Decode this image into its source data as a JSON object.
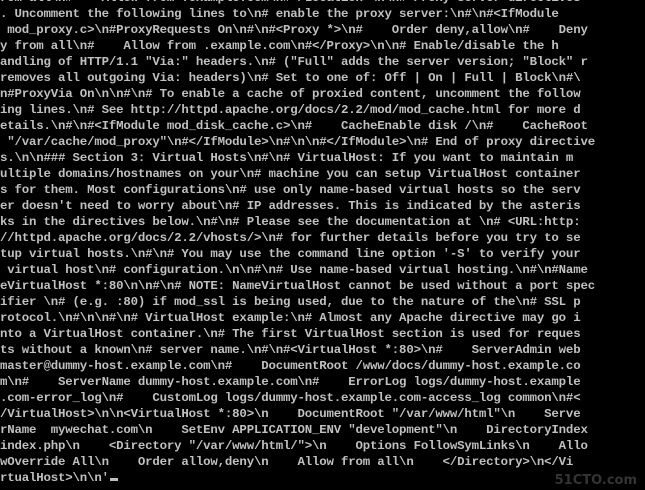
{
  "terminal": {
    "background_color": "#000000",
    "text_color": "#c0c0c0",
    "lines": [
      "rom all\\n#    Allow from .example.com\\n#</Location>\\n\\n# Proxy Server directives",
      ". Uncomment the following lines to\\n# enable the proxy server:\\n#\\n#<IfModule",
      " mod_proxy.c>\\n#ProxyRequests On\\n#\\n#<Proxy *>\\n#    Order deny,allow\\n#    Deny",
      "y from all\\n#    Allow from .example.com\\n#</Proxy>\\n\\n# Enable/disable the h",
      "andling of HTTP/1.1 \"Via:\" headers.\\n# (\"Full\" adds the server version; \"Block\" r",
      "removes all outgoing Via: headers)\\n# Set to one of: Off | On | Full | Block\\n#\\",
      "n#ProxyVia On\\n\\n#\\n# To enable a cache of proxied content, uncomment the follow",
      "ing lines.\\n# See http://httpd.apache.org/docs/2.2/mod/mod_cache.html for more d",
      "etails.\\n#\\n#<IfModule mod_disk_cache.c>\\n#    CacheEnable disk /\\n#    CacheRoot",
      " \"/var/cache/mod_proxy\"\\n#</IfModule>\\n#\\n\\n#</IfModule>\\n# End of proxy directive",
      "s.\\n\\n### Section 3: Virtual Hosts\\n#\\n# VirtualHost: If you want to maintain m",
      "ultiple domains/hostnames on your\\n# machine you can setup VirtualHost container",
      "s for them. Most configurations\\n# use only name-based virtual hosts so the serv",
      "er doesn't need to worry about\\n# IP addresses. This is indicated by the asteris",
      "ks in the directives below.\\n#\\n# Please see the documentation at \\n# <URL:http:",
      "//httpd.apache.org/docs/2.2/vhosts/>\\n# for further details before you try to se",
      "tup virtual hosts.\\n#\\n# You may use the command line option '-S' to verify your",
      " virtual host\\n# configuration.\\n\\n#\\n# Use name-based virtual hosting.\\n#\\n#Name",
      "eVirtualHost *:80\\n\\n#\\n# NOTE: NameVirtualHost cannot be used without a port spec",
      "ifier \\n# (e.g. :80) if mod_ssl is being used, due to the nature of the\\n# SSL p",
      "rotocol.\\n#\\n\\n#\\n# VirtualHost example:\\n# Almost any Apache directive may go i",
      "nto a VirtualHost container.\\n# The first VirtualHost section is used for reques",
      "ts without a known\\n# server name.\\n#\\n#<VirtualHost *:80>\\n#    ServerAdmin web",
      "master@dummy-host.example.com\\n#    DocumentRoot /www/docs/dummy-host.example.co",
      "m\\n#    ServerName dummy-host.example.com\\n#    ErrorLog logs/dummy-host.example",
      ".com-error_log\\n#    CustomLog logs/dummy-host.example.com-access_log common\\n#<",
      "/VirtualHost>\\n\\n<VirtualHost *:80>\\n    DocumentRoot \"/var/www/html\"\\n    Serve",
      "rName  mywechat.com\\n    SetEnv APPLICATION_ENV \"development\"\\n    DirectoryIndex",
      "index.php\\n    <Directory \"/var/www/html/\">\\n    Options FollowSymLinks\\n    Allo",
      "wOverride All\\n    Order allow,deny\\n    Allow from all\\n    </Directory>\\n</Vi",
      "rtualHost>\\n\\n'"
    ]
  },
  "watermark": "51CTO.com"
}
